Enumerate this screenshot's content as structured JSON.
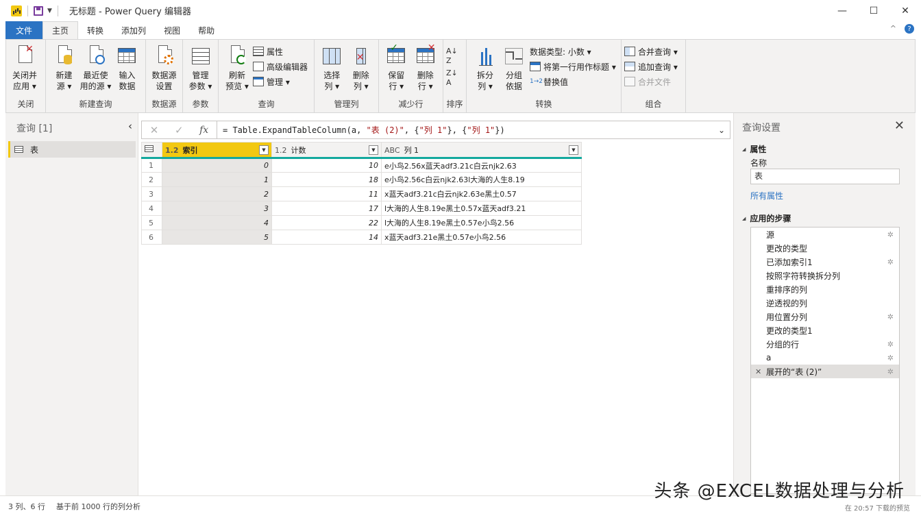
{
  "window": {
    "title": "无标题 - Power Query 编辑器",
    "minimize": "—",
    "maximize": "☐",
    "close": "✕"
  },
  "tabs": [
    "文件",
    "主页",
    "转换",
    "添加列",
    "视图",
    "帮助"
  ],
  "active_tab": "主页",
  "tab_bar_right": {
    "collapse": "^",
    "help": "?"
  },
  "ribbon": {
    "close_group": {
      "label": "关闭",
      "btn": "关闭并\n应用 ▾"
    },
    "new_query_group": {
      "label": "新建查询",
      "new_source": "新建\n源 ▾",
      "recent_sources": "最近使\n用的源 ▾",
      "enter_data": "输入\n数据"
    },
    "data_source_group": {
      "label": "数据源",
      "settings": "数据源\n设置"
    },
    "params_group": {
      "label": "参数",
      "manage": "管理\n参数 ▾"
    },
    "query_group": {
      "label": "查询",
      "refresh": "刷新\n预览 ▾",
      "properties": "属性",
      "advanced_editor": "高级编辑器",
      "manage": "管理 ▾"
    },
    "manage_cols_group": {
      "label": "管理列",
      "choose": "选择\n列 ▾",
      "remove": "删除\n列 ▾"
    },
    "reduce_rows_group": {
      "label": "减少行",
      "keep": "保留\n行 ▾",
      "remove": "删除\n行 ▾"
    },
    "sort_group": {
      "label": "排序"
    },
    "transform_group": {
      "label": "转换",
      "split": "拆分\n列 ▾",
      "group_by": "分组\n依据",
      "data_type": "数据类型: 小数 ▾",
      "first_row": "将第一行用作标题 ▾",
      "replace": "替换值"
    },
    "combine_group": {
      "label": "组合",
      "merge": "合并查询 ▾",
      "append": "追加查询 ▾",
      "combine_files": "合并文件"
    }
  },
  "queries_panel": {
    "title": "查询 [1]",
    "items": [
      "表"
    ]
  },
  "formula": {
    "cancel": "✕",
    "commit": "✓",
    "fx": "fx",
    "prefix": "= Table.ExpandTableColumn(a, ",
    "arg1": "\"表 (2)\"",
    "mid1": ", {",
    "arg2": "\"列 1\"",
    "mid2": "}, {",
    "arg3": "\"列 1\"",
    "suffix": "})"
  },
  "table": {
    "columns": [
      {
        "type": "1.2",
        "name": "索引"
      },
      {
        "type": "1.2",
        "name": "计数"
      },
      {
        "type": "ABC",
        "name": "列 1"
      }
    ],
    "rows": [
      {
        "n": "1",
        "idx": "0",
        "cnt": "10",
        "txt": "e小鸟2.56x蓝天adf3.21c白云njk2.63"
      },
      {
        "n": "2",
        "idx": "1",
        "cnt": "18",
        "txt": "e小鸟2.56c白云njk2.63l大海的人生8.19"
      },
      {
        "n": "3",
        "idx": "2",
        "cnt": "11",
        "txt": "x蓝天adf3.21c白云njk2.63e黑土0.57"
      },
      {
        "n": "4",
        "idx": "3",
        "cnt": "17",
        "txt": "l大海的人生8.19e黑土0.57x蓝天adf3.21"
      },
      {
        "n": "5",
        "idx": "4",
        "cnt": "22",
        "txt": "l大海的人生8.19e黑土0.57e小鸟2.56"
      },
      {
        "n": "6",
        "idx": "5",
        "cnt": "14",
        "txt": "x蓝天adf3.21e黑土0.57e小鸟2.56"
      }
    ]
  },
  "settings": {
    "title": "查询设置",
    "properties_label": "属性",
    "name_label": "名称",
    "name_value": "表",
    "all_properties": "所有属性",
    "steps_label": "应用的步骤",
    "steps": [
      {
        "label": "源",
        "gear": true
      },
      {
        "label": "更改的类型",
        "gear": false
      },
      {
        "label": "已添加索引1",
        "gear": true
      },
      {
        "label": "按照字符转换拆分列",
        "gear": false
      },
      {
        "label": "重排序的列",
        "gear": false
      },
      {
        "label": "逆透视的列",
        "gear": false
      },
      {
        "label": "用位置分列",
        "gear": true
      },
      {
        "label": "更改的类型1",
        "gear": false
      },
      {
        "label": "分组的行",
        "gear": true
      },
      {
        "label": "a",
        "gear": true
      },
      {
        "label": "展开的“表 (2)”",
        "gear": true,
        "active": true
      }
    ]
  },
  "status": {
    "rows_cols": "3 列、6 行",
    "profiling": "基于前 1000 行的列分析",
    "preview": "在 20:57 下载的预览"
  },
  "watermark": "头条 @EXCEL数据处理与分析"
}
